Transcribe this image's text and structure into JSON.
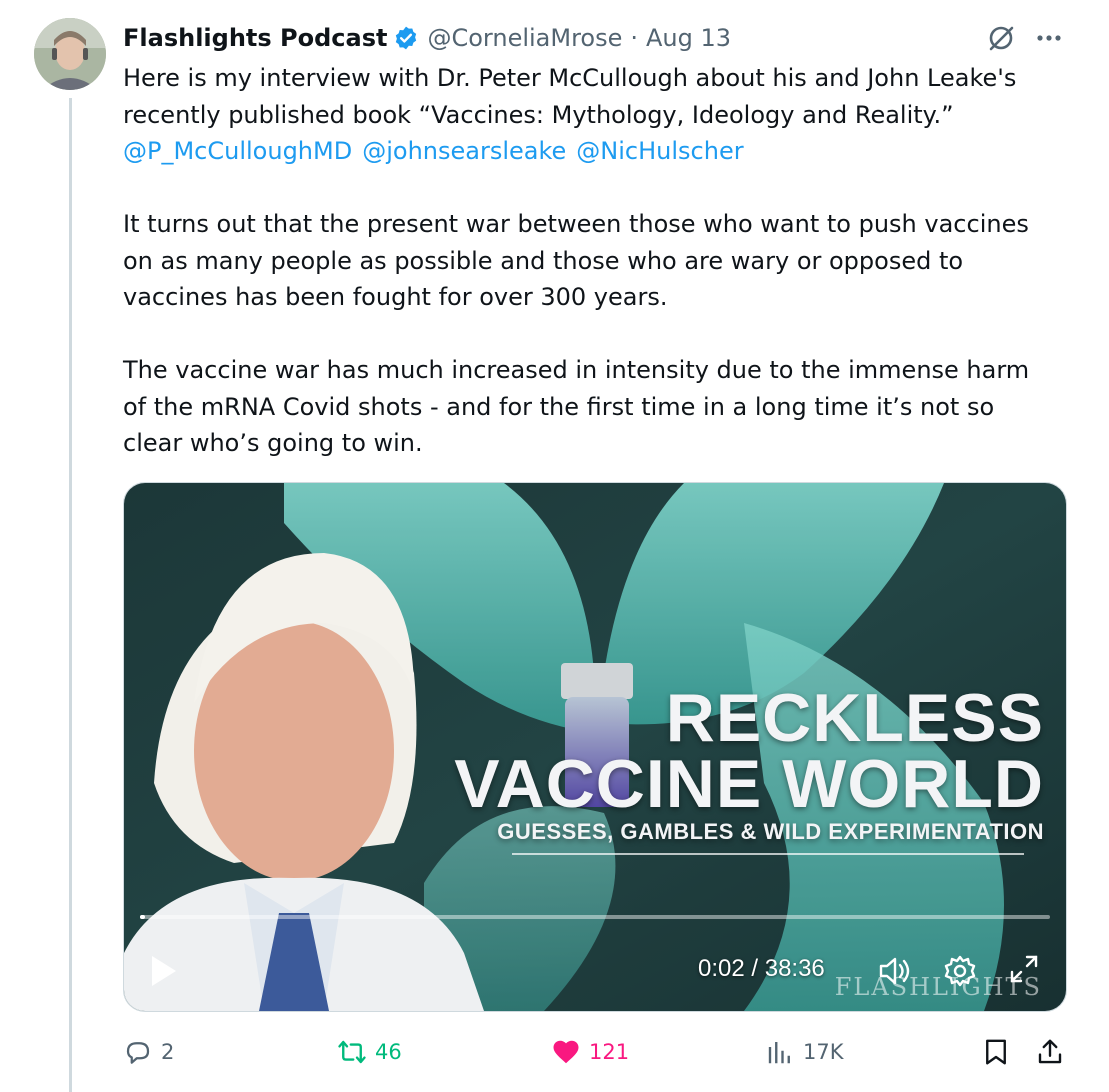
{
  "tweet": {
    "display_name": "Flashlights Podcast",
    "verified_icon": "verified-badge-icon",
    "handle": "@CorneliaMrose",
    "separator": "·",
    "date": "Aug 13",
    "text_lines": [
      "Here is my interview with Dr. Peter McCullough about his and John Leake's",
      "recently published book “Vaccines: Mythology, Ideology and Reality.”"
    ],
    "mentions": [
      "@P_McCulloughMD",
      "@johnsearsleake",
      "@NicHulscher"
    ],
    "paragraph2": [
      "It turns out that the present war between those who want to push vaccines",
      "on as many people as possible and those who are wary or opposed to",
      "vaccines has been fought for over 300 years."
    ],
    "paragraph3": [
      "The vaccine war has much increased in intensity due to the immense harm",
      "of the mRNA Covid shots - and for the first time in a long time it’s not so",
      "clear who’s going to win."
    ]
  },
  "video": {
    "headline_line1": "RECKLESS",
    "headline_line2": "VACCINE WORLD",
    "subheadline": "GUESSES, GAMBLES & WILD EXPERIMENTATION",
    "watermark": "FLASHLIGHTS",
    "time_display": "0:02 / 38:36",
    "progress_fraction": 0.001
  },
  "actions": {
    "replies": "2",
    "reposts": "46",
    "likes": "121",
    "views": "17K"
  },
  "colors": {
    "accent": "#1d9bf0",
    "repost": "#00ba7c",
    "like": "#f91880",
    "muted": "#536471"
  }
}
